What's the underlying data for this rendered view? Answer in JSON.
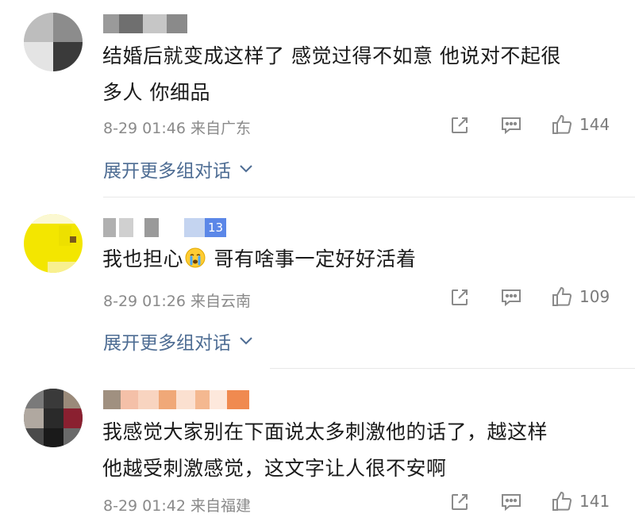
{
  "comments": [
    {
      "text_line1": "结婚后就变成这样了 感觉过得不如意 他说对不起很",
      "text_line2": "多人 你细品",
      "time": "8-29 01:46",
      "location": "来自广东",
      "likes": "144",
      "expand_label": "展开更多组对话"
    },
    {
      "badge": "13",
      "text_before_emoji": "我也担心",
      "emoji": "crying-face",
      "text_after_emoji": " 哥有啥事一定好好活着",
      "time": "8-29 01:26",
      "location": "来自云南",
      "likes": "109",
      "expand_label": "展开更多组对话"
    },
    {
      "text_line1": "我感觉大家别在下面说太多刺激他的话了，越这样",
      "text_line2": "他越受刺激感觉，这文字让人很不安啊",
      "time": "8-29 01:42",
      "location": "来自福建",
      "likes": "141"
    }
  ],
  "colors": {
    "link_blue": "#4d6c93",
    "meta_gray": "#8a8a8a",
    "text": "#1a1a1a"
  }
}
